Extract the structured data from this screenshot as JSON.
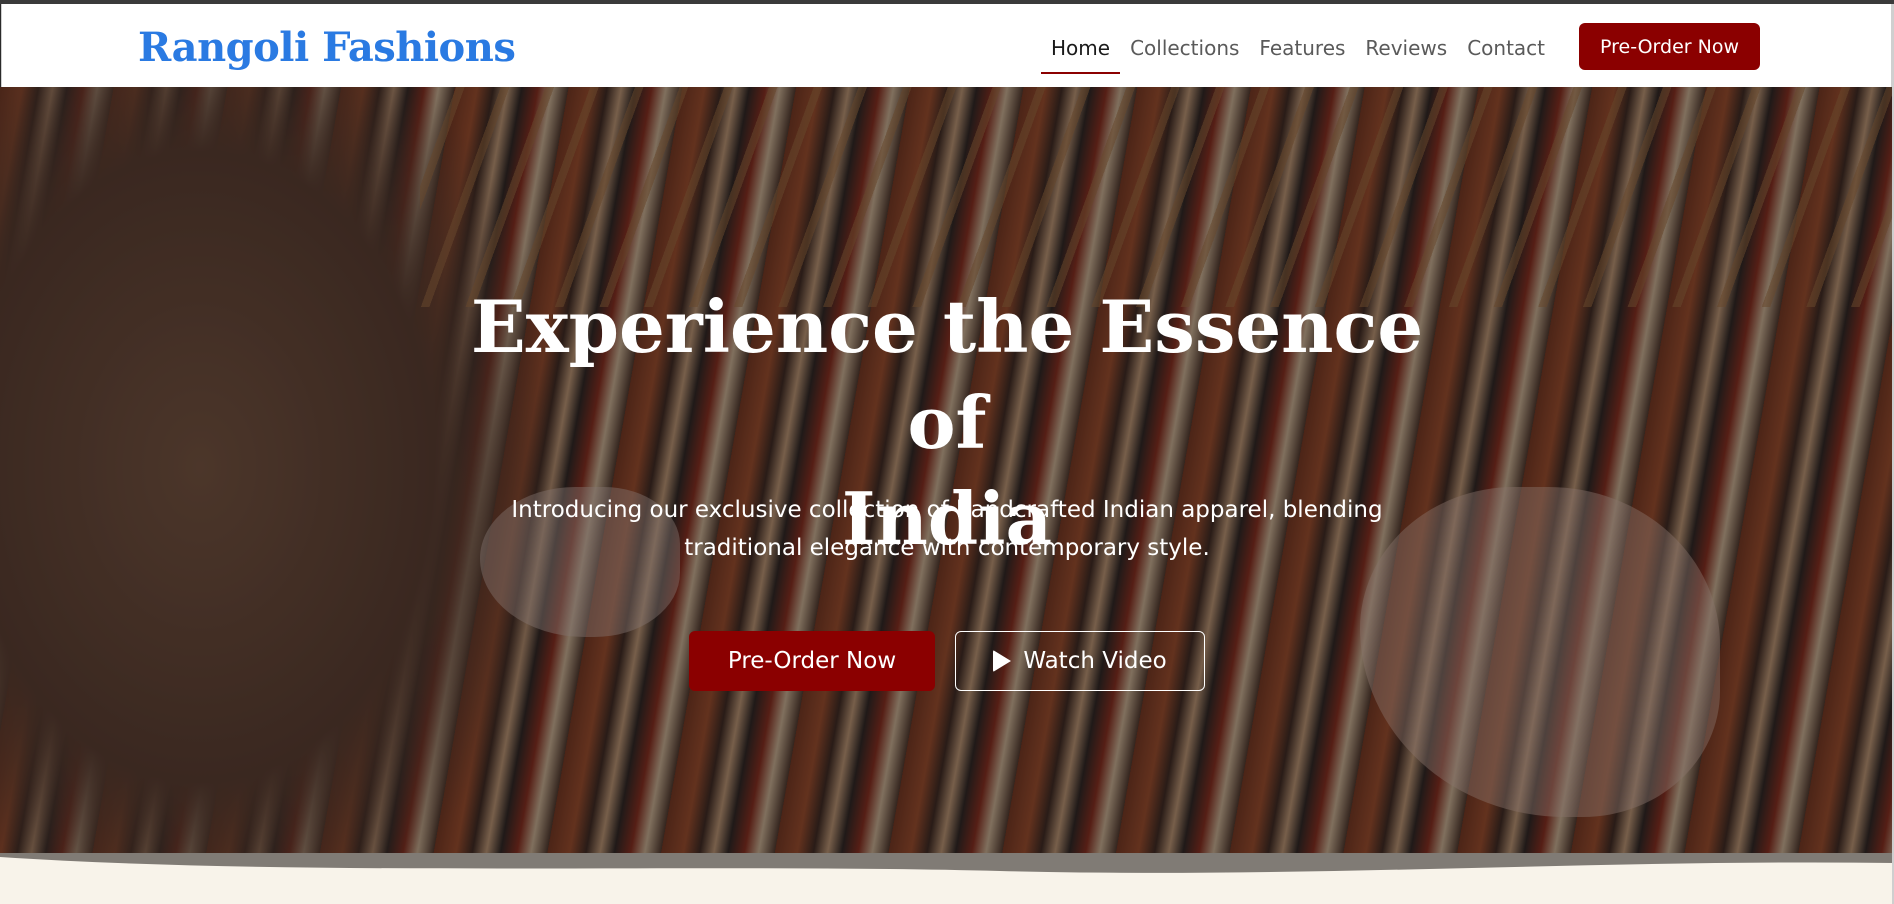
{
  "brand": {
    "name": "Rangoli Fashions",
    "color": "#2a7ae2",
    "accent": "#8b0000"
  },
  "nav": {
    "links": [
      {
        "label": "Home",
        "active": true
      },
      {
        "label": "Collections",
        "active": false
      },
      {
        "label": "Features",
        "active": false
      },
      {
        "label": "Reviews",
        "active": false
      },
      {
        "label": "Contact",
        "active": false
      }
    ],
    "cta_label": "Pre-Order Now"
  },
  "hero": {
    "title_line1": "Experience the Essence of",
    "title_line2": "India",
    "subtitle_line1": "Introducing our exclusive collection of handcrafted Indian apparel, blending",
    "subtitle_line2": "traditional elegance with contemporary style.",
    "primary_button": "Pre-Order Now",
    "secondary_button": "Watch Video",
    "secondary_icon": "play-icon"
  }
}
